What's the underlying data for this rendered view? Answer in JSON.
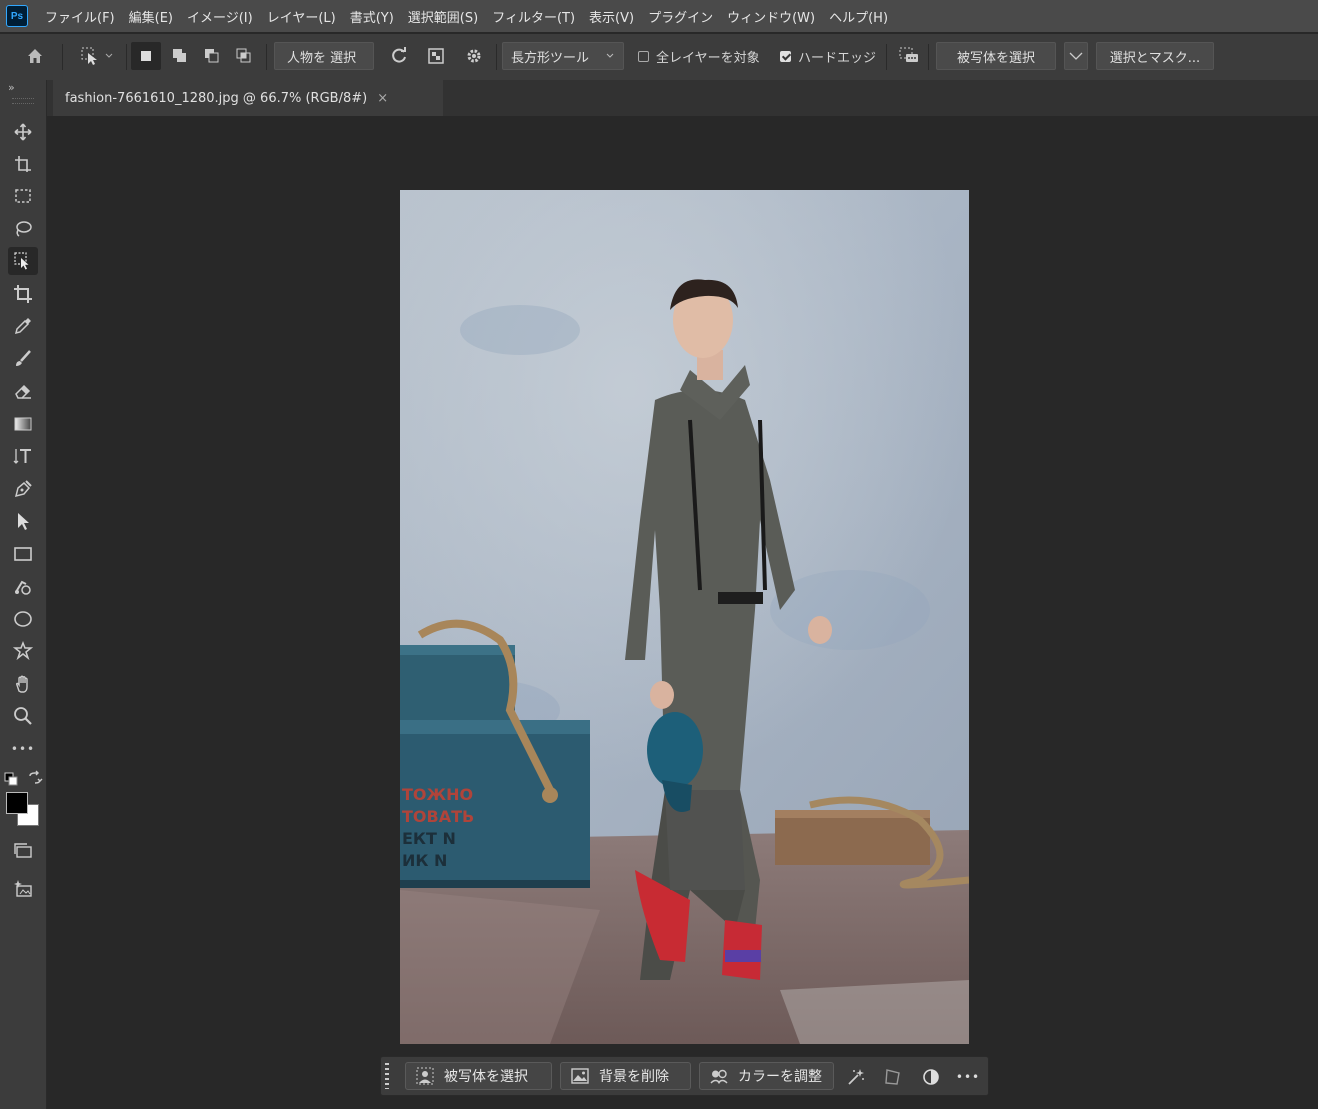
{
  "app": {
    "logo_text": "Ps"
  },
  "menu": [
    "ファイル(F)",
    "編集(E)",
    "イメージ(I)",
    "レイヤー(L)",
    "書式(Y)",
    "選択範囲(S)",
    "フィルター(T)",
    "表示(V)",
    "プラグイン",
    "ウィンドウ(W)",
    "ヘルプ(H)"
  ],
  "options": {
    "select_person_label": "人物を 選択",
    "tool_mode_value": "長方形ツール",
    "all_layers_label": "全レイヤーを対象",
    "all_layers_checked": false,
    "hard_edge_label": "ハードエッジ",
    "hard_edge_checked": true,
    "select_subject_label": "被写体を選択",
    "select_mask_label": "選択とマスク..."
  },
  "document": {
    "tab_title": "fashion-7661610_1280.jpg @ 66.7% (RGB/8#)",
    "close_glyph": "×"
  },
  "taskbar": {
    "select_subject_label": "被写体を選択",
    "remove_bg_label": "背景を削除",
    "adjust_color_label": "カラーを調整",
    "more_glyph": "•••"
  },
  "toolbar": {
    "expand_glyph": "»",
    "more_tools_glyph": "•••"
  },
  "colors": {
    "foreground": "#000000",
    "background": "#ffffff",
    "ps_blue": "#31a8ff"
  }
}
